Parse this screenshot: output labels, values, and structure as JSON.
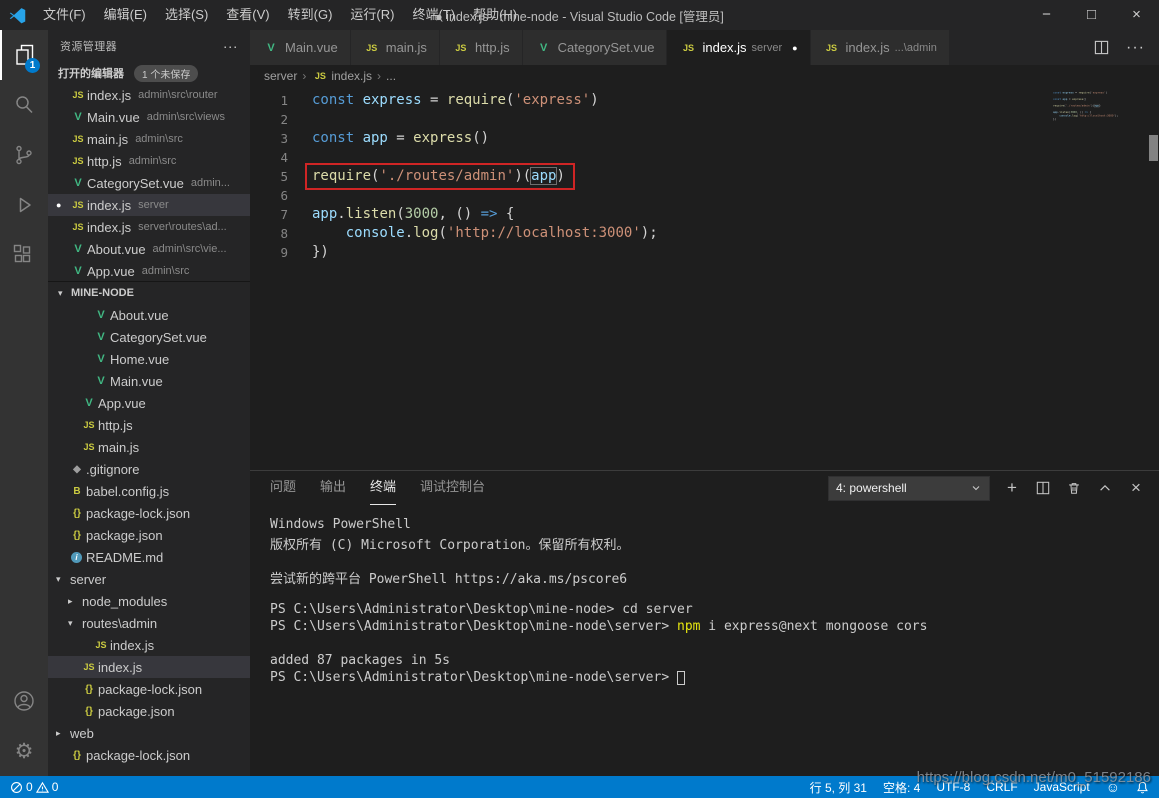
{
  "title_bar": {
    "menus": [
      "文件(F)",
      "编辑(E)",
      "选择(S)",
      "查看(V)",
      "转到(G)",
      "运行(R)",
      "终端(T)",
      "帮助(H)"
    ],
    "title": "● index.js - mine-node - Visual Studio Code [管理员]",
    "window_controls": {
      "minimize": "−",
      "maximize": "□",
      "close": "×"
    }
  },
  "activity_bar": {
    "explorer_badge": "1"
  },
  "colors": {
    "accent": "#007acc",
    "annotation_box": "#cf2525",
    "terminal_command": "#e5e510",
    "statusbar": "#007acc"
  },
  "sidebar": {
    "header": "资源管理器",
    "open_editors": {
      "title": "打开的编辑器",
      "badge": "1 个未保存",
      "items": [
        {
          "icon": "js",
          "name": "index.js",
          "detail": "admin\\src\\router",
          "dirty": false,
          "selected": false
        },
        {
          "icon": "vue",
          "name": "Main.vue",
          "detail": "admin\\src\\views",
          "dirty": false,
          "selected": false
        },
        {
          "icon": "js",
          "name": "main.js",
          "detail": "admin\\src",
          "dirty": false,
          "selected": false
        },
        {
          "icon": "js",
          "name": "http.js",
          "detail": "admin\\src",
          "dirty": false,
          "selected": false
        },
        {
          "icon": "vue",
          "name": "CategorySet.vue",
          "detail": "admin...",
          "dirty": false,
          "selected": false
        },
        {
          "icon": "js",
          "name": "index.js",
          "detail": "server",
          "dirty": true,
          "selected": true
        },
        {
          "icon": "js",
          "name": "index.js",
          "detail": "server\\routes\\ad...",
          "dirty": false,
          "selected": false
        },
        {
          "icon": "vue",
          "name": "About.vue",
          "detail": "admin\\src\\vie...",
          "dirty": false,
          "selected": false
        },
        {
          "icon": "vue",
          "name": "App.vue",
          "detail": "admin\\src",
          "dirty": false,
          "selected": false
        }
      ]
    },
    "tree": {
      "title": "MINE-NODE",
      "items": [
        {
          "type": "file",
          "icon": "vue",
          "name": "About.vue",
          "level": 3,
          "selected": false
        },
        {
          "type": "file",
          "icon": "vue",
          "name": "CategorySet.vue",
          "level": 3,
          "selected": false
        },
        {
          "type": "file",
          "icon": "vue",
          "name": "Home.vue",
          "level": 3,
          "selected": false
        },
        {
          "type": "file",
          "icon": "vue",
          "name": "Main.vue",
          "level": 3,
          "selected": false
        },
        {
          "type": "file",
          "icon": "vue",
          "name": "App.vue",
          "level": 2,
          "selected": false
        },
        {
          "type": "file",
          "icon": "js",
          "name": "http.js",
          "level": 2,
          "selected": false
        },
        {
          "type": "file",
          "icon": "js",
          "name": "main.js",
          "level": 2,
          "selected": false
        },
        {
          "type": "file",
          "icon": "git",
          "name": ".gitignore",
          "level": 1,
          "selected": false
        },
        {
          "type": "file",
          "icon": "babel",
          "name": "babel.config.js",
          "level": 1,
          "selected": false
        },
        {
          "type": "file",
          "icon": "json",
          "name": "package-lock.json",
          "level": 1,
          "selected": false
        },
        {
          "type": "file",
          "icon": "json",
          "name": "package.json",
          "level": 1,
          "selected": false
        },
        {
          "type": "file",
          "icon": "md",
          "name": "README.md",
          "level": 1,
          "selected": false
        },
        {
          "type": "folder",
          "name": "server",
          "level": 1,
          "expanded": true,
          "selected": false
        },
        {
          "type": "folder",
          "name": "node_modules",
          "level": 2,
          "expanded": false,
          "selected": false
        },
        {
          "type": "folder",
          "name": "routes\\admin",
          "level": 2,
          "expanded": true,
          "selected": false
        },
        {
          "type": "file",
          "icon": "js",
          "name": "index.js",
          "level": 3,
          "selected": false
        },
        {
          "type": "file",
          "icon": "js",
          "name": "index.js",
          "level": 2,
          "selected": true
        },
        {
          "type": "file",
          "icon": "json",
          "name": "package-lock.json",
          "level": 2,
          "selected": false
        },
        {
          "type": "file",
          "icon": "json",
          "name": "package.json",
          "level": 2,
          "selected": false
        },
        {
          "type": "folder",
          "name": "web",
          "level": 1,
          "expanded": false,
          "selected": false
        },
        {
          "type": "file",
          "icon": "json",
          "name": "package-lock.json",
          "level": 1,
          "selected": false
        }
      ]
    }
  },
  "tabs": [
    {
      "icon": "vue",
      "label": "Main.vue",
      "detail": "",
      "dirty": false,
      "active": false
    },
    {
      "icon": "js",
      "label": "main.js",
      "detail": "",
      "dirty": false,
      "active": false
    },
    {
      "icon": "js",
      "label": "http.js",
      "detail": "",
      "dirty": false,
      "active": false
    },
    {
      "icon": "vue",
      "label": "CategorySet.vue",
      "detail": "",
      "dirty": false,
      "active": false
    },
    {
      "icon": "js",
      "label": "index.js",
      "detail": "server",
      "dirty": true,
      "active": true
    },
    {
      "icon": "js",
      "label": "index.js",
      "detail": "...\\admin",
      "dirty": false,
      "active": false
    }
  ],
  "breadcrumb": [
    {
      "label": "server",
      "icon": ""
    },
    {
      "label": "index.js",
      "icon": "js"
    },
    {
      "label": "...",
      "icon": ""
    }
  ],
  "editor": {
    "lines": [
      {
        "num": "1",
        "tokens": [
          {
            "t": "const ",
            "c": "kw"
          },
          {
            "t": "express",
            "c": "var"
          },
          {
            "t": " = ",
            "c": "pun"
          },
          {
            "t": "require",
            "c": "fn"
          },
          {
            "t": "(",
            "c": "pun"
          },
          {
            "t": "'express'",
            "c": "str"
          },
          {
            "t": ")",
            "c": "pun"
          }
        ]
      },
      {
        "num": "2",
        "tokens": []
      },
      {
        "num": "3",
        "tokens": [
          {
            "t": "const ",
            "c": "kw"
          },
          {
            "t": "app",
            "c": "var"
          },
          {
            "t": " = ",
            "c": "pun"
          },
          {
            "t": "express",
            "c": "fn"
          },
          {
            "t": "()",
            "c": "pun"
          }
        ]
      },
      {
        "num": "4",
        "tokens": []
      },
      {
        "num": "5",
        "tokens": [
          {
            "t": "require",
            "c": "fn"
          },
          {
            "t": "(",
            "c": "pun"
          },
          {
            "t": "'./routes/admin'",
            "c": "str"
          },
          {
            "t": ")(",
            "c": "pun"
          },
          {
            "t": "app",
            "c": "var hl"
          },
          {
            "t": ")",
            "c": "pun"
          }
        ]
      },
      {
        "num": "6",
        "tokens": []
      },
      {
        "num": "7",
        "tokens": [
          {
            "t": "app",
            "c": "var"
          },
          {
            "t": ".",
            "c": "pun"
          },
          {
            "t": "listen",
            "c": "fn"
          },
          {
            "t": "(",
            "c": "pun"
          },
          {
            "t": "3000",
            "c": "num"
          },
          {
            "t": ", () ",
            "c": "pun"
          },
          {
            "t": "=>",
            "c": "kw"
          },
          {
            "t": " {",
            "c": "pun"
          }
        ]
      },
      {
        "num": "8",
        "tokens": [
          {
            "t": "    ",
            "c": "pun"
          },
          {
            "t": "console",
            "c": "var"
          },
          {
            "t": ".",
            "c": "pun"
          },
          {
            "t": "log",
            "c": "fn"
          },
          {
            "t": "(",
            "c": "pun"
          },
          {
            "t": "'http://localhost:3000'",
            "c": "str"
          },
          {
            "t": ");",
            "c": "pun"
          }
        ]
      },
      {
        "num": "9",
        "tokens": [
          {
            "t": "})",
            "c": "pun"
          }
        ]
      }
    ]
  },
  "panel": {
    "tabs": [
      {
        "label": "问题",
        "active": false
      },
      {
        "label": "输出",
        "active": false
      },
      {
        "label": "终端",
        "active": true
      },
      {
        "label": "调试控制台",
        "active": false
      }
    ],
    "dropdown": "4: powershell"
  },
  "terminal": {
    "lines": [
      [
        {
          "t": "Windows PowerShell",
          "c": "plain"
        }
      ],
      [
        {
          "t": "版权所有 (C) Microsoft Corporation。保留所有权利。",
          "c": "plain"
        }
      ],
      [],
      [
        {
          "t": "尝试新的跨平台 PowerShell https://aka.ms/pscore6",
          "c": "plain"
        }
      ],
      [],
      [
        {
          "t": "PS C:\\Users\\Administrator\\Desktop\\mine-node> cd server",
          "c": "plain"
        }
      ],
      [
        {
          "t": "PS C:\\Users\\Administrator\\Desktop\\mine-node\\server> ",
          "c": "plain"
        },
        {
          "t": "npm",
          "c": "cmd"
        },
        {
          "t": " i express@next mongoose cors",
          "c": "plain"
        }
      ],
      [],
      [
        {
          "t": "added 87 packages in 5s",
          "c": "plain"
        }
      ],
      [
        {
          "t": "PS C:\\Users\\Administrator\\Desktop\\mine-node\\server> ",
          "c": "plain"
        },
        {
          "t": " ",
          "c": "cursor"
        }
      ]
    ]
  },
  "status_bar": {
    "errors": "0",
    "warnings": "0",
    "cursor": "行 5, 列 31",
    "indent": "空格: 4",
    "encoding": "UTF-8",
    "eol": "CRLF",
    "language": "JavaScript"
  },
  "watermark": "https://blog.csdn.net/m0_51592186"
}
